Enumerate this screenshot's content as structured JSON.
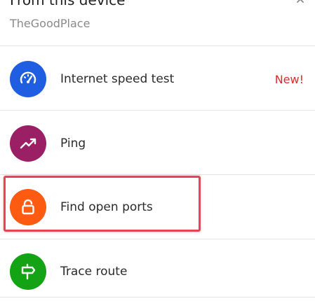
{
  "header": {
    "title": "From this device",
    "network_name": "TheGoodPlace"
  },
  "tools": [
    {
      "label": "Internet speed test",
      "icon": "speedometer-icon",
      "color": "#1f5ee0",
      "badge": "New!"
    },
    {
      "label": "Ping",
      "icon": "trend-up-icon",
      "color": "#9b1f64",
      "badge": ""
    },
    {
      "label": "Find open ports",
      "icon": "lock-icon",
      "color": "#fd5a12",
      "badge": "",
      "highlighted": true
    },
    {
      "label": "Trace route",
      "icon": "signpost-icon",
      "color": "#14a314",
      "badge": ""
    }
  ],
  "colors": {
    "badge": "#e02a2a",
    "highlight_outline": "#e84350"
  }
}
